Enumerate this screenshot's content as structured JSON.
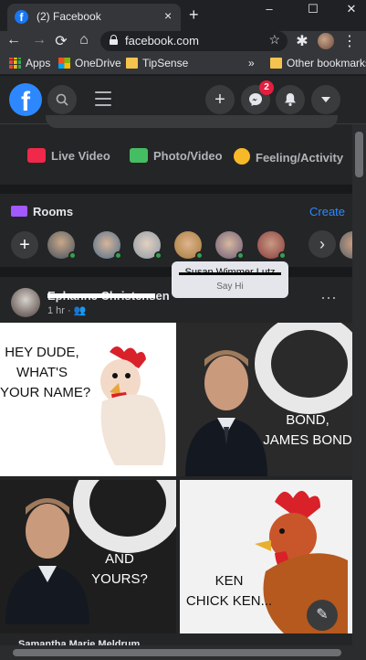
{
  "browser": {
    "tab_title": "(2) Facebook",
    "tab_favicon": "facebook-f-icon",
    "tab_close": "×",
    "new_tab": "+",
    "window_controls": {
      "minimize": "–",
      "maximize": "☐",
      "close": "✕"
    },
    "url": "facebook.com",
    "nav": {
      "back": "←",
      "forward": "→",
      "reload": "⟳",
      "home": "⌂"
    },
    "star": "☆",
    "extensions": "✱",
    "menu": "⋮",
    "bookmarks": [
      "Apps",
      "OneDrive",
      "TipSense"
    ],
    "bookmarks_overflow": "»",
    "other_bookmarks": "Other bookmarks"
  },
  "fb": {
    "logo": "f",
    "messenger_badge": "2",
    "icons": {
      "search": "search-icon",
      "menu": "hamburger-icon",
      "create": "plus-icon",
      "messenger": "messenger-icon",
      "notifications": "bell-icon",
      "account": "caret-down-icon"
    },
    "header_buttons": {
      "create": "+",
      "messenger": "✉",
      "notifications": "🔔",
      "account": "▾",
      "search": "⌕"
    },
    "composer_actions": [
      {
        "label": "Live Video",
        "color": "#f02849"
      },
      {
        "label": "Photo/Video",
        "color": "#45bd62"
      },
      {
        "label": "Feeling/Activity",
        "color": "#f7b928"
      }
    ],
    "rooms": {
      "title": "Rooms",
      "create": "Create",
      "plus": "+",
      "next": "›",
      "tooltip_name": "Susan Wimmer Lutz",
      "tooltip_action": "Say Hi"
    },
    "post": {
      "author": "Ephanne Christensen",
      "time": "1 hr · ",
      "more": "···",
      "meme": {
        "top_left": "HEY DUDE,\nWHAT'S\nYOUR NAME?",
        "top_right": "BOND,\nJAMES BOND",
        "bottom_left": "AND\nYOURS?",
        "bottom_right": "KEN\nCHICK KEN..."
      },
      "footer_name": "Samantha Marie Meldrum"
    },
    "fab": "✎"
  }
}
